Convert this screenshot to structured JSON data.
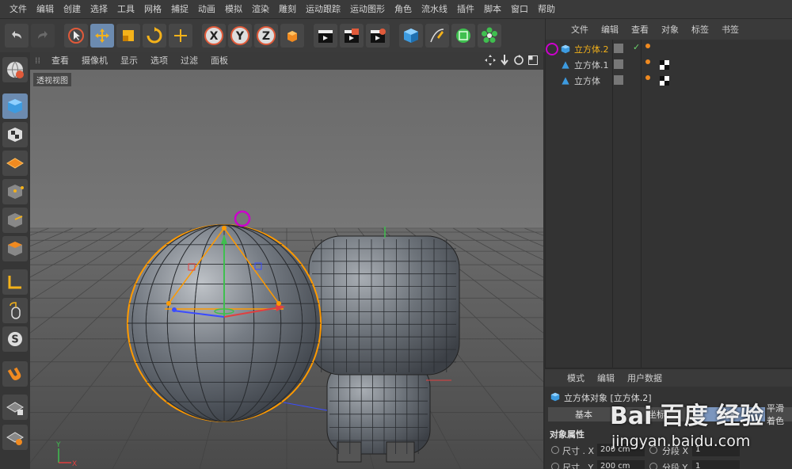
{
  "menubar": {
    "items": [
      "文件",
      "编辑",
      "创建",
      "选择",
      "工具",
      "网格",
      "捕捉",
      "动画",
      "模拟",
      "渲染",
      "雕刻",
      "运动跟踪",
      "运动图形",
      "角色",
      "流水线",
      "插件",
      "脚本",
      "窗口",
      "帮助"
    ]
  },
  "toolbar": {
    "undo_icon": "undo-icon",
    "redo_icon": "redo-icon",
    "tools": [
      "select-icon",
      "move-icon",
      "scale-icon",
      "rotate-icon",
      "add-icon"
    ],
    "axes": [
      "X",
      "Y",
      "Z"
    ]
  },
  "viewport": {
    "menu": [
      "查看",
      "摄像机",
      "显示",
      "选项",
      "过滤",
      "面板"
    ],
    "label": "透视视图",
    "colors": {
      "sky": "#707070",
      "floor": "#5a5a5a",
      "selection": "#ff9a00",
      "handle": "#cc00cc"
    }
  },
  "object_manager": {
    "menu": [
      "文件",
      "编辑",
      "查看",
      "对象",
      "标签",
      "书签"
    ],
    "objects": [
      {
        "name": "立方体.2",
        "selected": true
      },
      {
        "name": "立方体.1",
        "selected": false
      },
      {
        "name": "立方体",
        "selected": false
      }
    ]
  },
  "attributes": {
    "menu": [
      "模式",
      "编辑",
      "用户数据"
    ],
    "title": "立方体对象 [立方体.2]",
    "tabs": [
      "基本",
      "坐标",
      "对象",
      "平滑着色"
    ],
    "section": "对象属性",
    "fields": [
      {
        "label": "尺寸 . X",
        "value": "200 cm",
        "seg_label": "分段 X",
        "seg_value": "1"
      },
      {
        "label": "尺寸 . Y",
        "value": "200 cm",
        "seg_label": "分段 Y",
        "seg_value": "1"
      }
    ]
  },
  "watermark": {
    "brand": "Bai  百度  经验",
    "url": "jingyan.baidu.com"
  }
}
